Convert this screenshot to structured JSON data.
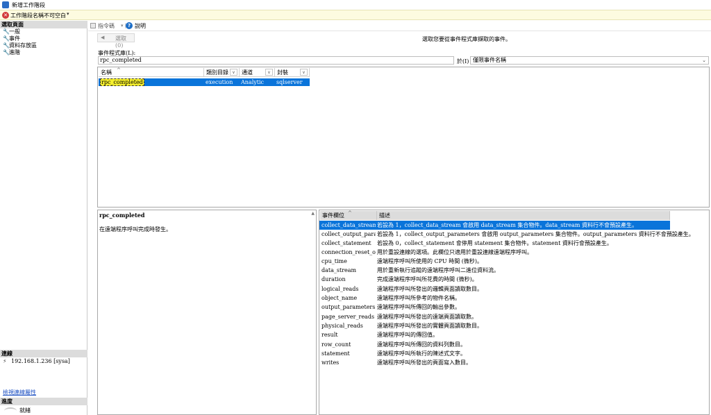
{
  "window": {
    "title": "新增工作階段"
  },
  "error_bar": {
    "message": "工作階段名稱不可空白"
  },
  "left": {
    "select_page_header": "選取頁面",
    "nav": [
      "一般",
      "事件",
      "資料存放區",
      "進階"
    ],
    "connection_header": "連線",
    "connection_item": "192.168.1.236 [sysa]",
    "connection_link": "檢視連線屬性",
    "progress_header": "進度",
    "progress_status": "就緒"
  },
  "toolbar": {
    "script": "指令碼",
    "help": "說明"
  },
  "main": {
    "select_button": "選取(0)",
    "hint": "選取您要從事件程式庫擷取的事件。",
    "library_label": "事件程式庫(L):",
    "library_value": "rpc_completed",
    "in_label": "於(I)",
    "scope_value": "僅限事件名稱"
  },
  "event_grid": {
    "columns": [
      "名稱",
      "類別目錄",
      "通道",
      "封裝"
    ],
    "rows": [
      {
        "name": "rpc_completed",
        "category": "execution",
        "channel": "Analytic",
        "package": "sqlserver"
      }
    ]
  },
  "description": {
    "name": "rpc_completed",
    "text": "在遠端程序呼叫完成時發生。"
  },
  "field_grid": {
    "columns": [
      "事件欄位",
      "描述"
    ],
    "rows": [
      {
        "field": "collect_data_stream",
        "desc": "若設為 1，collect_data_stream 會啟用 data_stream 集合物件。data_stream 資料行不會預設產生。",
        "selected": true
      },
      {
        "field": "collect_output_paramet...",
        "desc": "若設為 1，collect_output_parameters 會啟用 output_parameters 集合物件。output_parameters 資料行不會預設產生。"
      },
      {
        "field": "collect_statement",
        "desc": "若設為 0，collect_statement 會停用 statement 集合物件。statement 資料行會預設產生。"
      },
      {
        "field": "connection_reset_option",
        "desc": "用於重設連線的選項。此欄位只適用於重設連線遠端程序呼叫。"
      },
      {
        "field": "cpu_time",
        "desc": "遠端程序呼叫所使用的 CPU 時間 (微秒)。"
      },
      {
        "field": "data_stream",
        "desc": "用於重新執行追蹤的遠端程序呼叫二進位資料流。"
      },
      {
        "field": "duration",
        "desc": "完成遠端程序呼叫所花費的時間 (微秒)。"
      },
      {
        "field": "logical_reads",
        "desc": "遠端程序呼叫所發出的邏輯頁面讀取數目。"
      },
      {
        "field": "object_name",
        "desc": "遠端程序呼叫所參考的物件名稱。"
      },
      {
        "field": "output_parameters",
        "desc": "遠端程序呼叫所傳回的輸出參數。"
      },
      {
        "field": "page_server_reads",
        "desc": "遠端程序呼叫所發出的遠端頁面讀取數。"
      },
      {
        "field": "physical_reads",
        "desc": "遠端程序呼叫所發出的實體頁面讀取數目。"
      },
      {
        "field": "result",
        "desc": "遠端程序呼叫的傳回值。"
      },
      {
        "field": "row_count",
        "desc": "遠端程序呼叫所傳回的資料列數目。"
      },
      {
        "field": "statement",
        "desc": "遠端程序呼叫所執行的陳述式文字。"
      },
      {
        "field": "writes",
        "desc": "遠端程序呼叫所發出的頁面寫入數目。"
      }
    ]
  }
}
